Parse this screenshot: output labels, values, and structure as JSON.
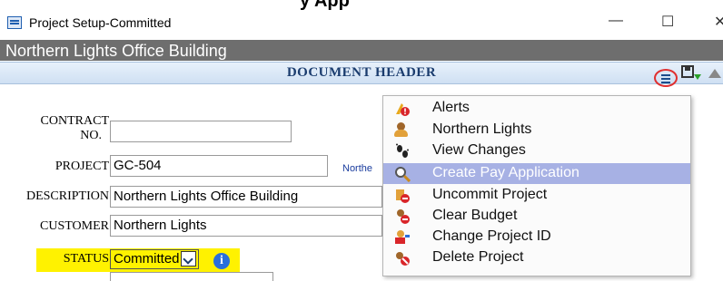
{
  "top_cut_title": "y App",
  "window": {
    "title": "Project Setup-Committed",
    "minimize": "—",
    "maximize": "☐",
    "close": "✕"
  },
  "project_title": "Northern Lights Office Building",
  "section": {
    "title": "DOCUMENT HEADER"
  },
  "form": {
    "contract_label_line1": "CONTRACT",
    "contract_label_line2": "NO.",
    "contract_value": "",
    "project_label": "PROJECT",
    "project_value": "GC-504",
    "project_link": "Northe",
    "description_label": "DESCRIPTION",
    "description_value": "Northern Lights Office Building",
    "customer_label": "CUSTOMER",
    "customer_value": "Northern Lights",
    "status_label": "STATUS",
    "status_value": "Committed"
  },
  "menu": {
    "items": [
      {
        "label": "Alerts",
        "icon": "alert-icon"
      },
      {
        "label": "Northern Lights",
        "icon": "customer-icon"
      },
      {
        "label": "View Changes",
        "icon": "footprints-icon"
      },
      {
        "label": "Create Pay Application",
        "icon": "magnifier-icon",
        "highlighted": true
      },
      {
        "label": "Uncommit Project",
        "icon": "uncommit-icon"
      },
      {
        "label": "Clear Budget",
        "icon": "clear-budget-icon"
      },
      {
        "label": "Change Project ID",
        "icon": "change-id-icon"
      },
      {
        "label": "Delete Project",
        "icon": "delete-project-icon"
      }
    ]
  },
  "colors": {
    "highlight_menu": "#a7b1e4",
    "status_highlight": "#fff200",
    "project_bar": "#6e6e6e",
    "section_text": "#1a3c6e",
    "menu_circle": "#e03030"
  }
}
